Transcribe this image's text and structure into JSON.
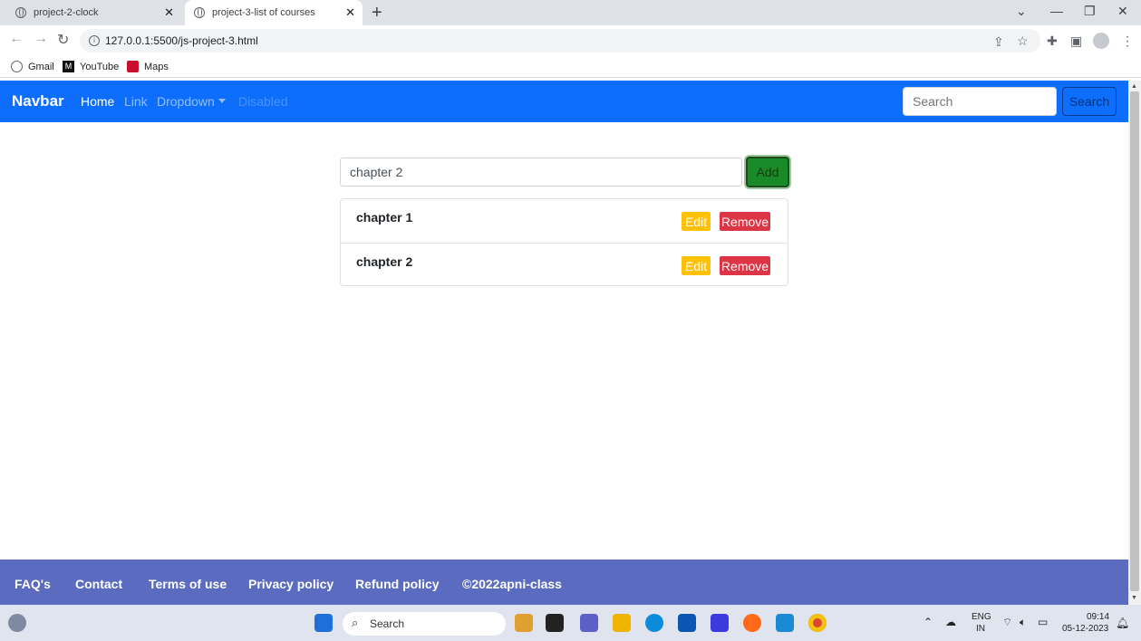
{
  "browser": {
    "tabs": [
      {
        "title": "project-2-clock"
      },
      {
        "title": "project-3-list of courses"
      }
    ],
    "url": "127.0.0.1:5500/js-project-3.html",
    "bookmarks": [
      "Gmail",
      "YouTube",
      "Maps"
    ]
  },
  "navbar": {
    "brand": "Navbar",
    "links": [
      "Home",
      "Link",
      "Dropdown",
      "Disabled"
    ],
    "search_placeholder": "Search",
    "search_button": "Search"
  },
  "app": {
    "input_value": "chapter 2",
    "add_label": "Add",
    "courses": [
      {
        "name": "chapter 1",
        "edit": "Edit",
        "remove": "Remove"
      },
      {
        "name": "chapter 2",
        "edit": "Edit",
        "remove": "Remove"
      }
    ]
  },
  "footer": {
    "links": [
      "FAQ's",
      "Contact",
      "Terms of use",
      "Privacy policy",
      "Refund policy",
      "©2022apni-class"
    ]
  },
  "taskbar": {
    "search": "Search",
    "lang": "ENG",
    "region": "IN",
    "time": "09:14",
    "date": "05-12-2023"
  },
  "colors": {
    "navbar": "#0d6efd",
    "footer": "#5b6bbf",
    "add": "#198a28",
    "edit": "#ffc107",
    "remove": "#dc3545"
  }
}
